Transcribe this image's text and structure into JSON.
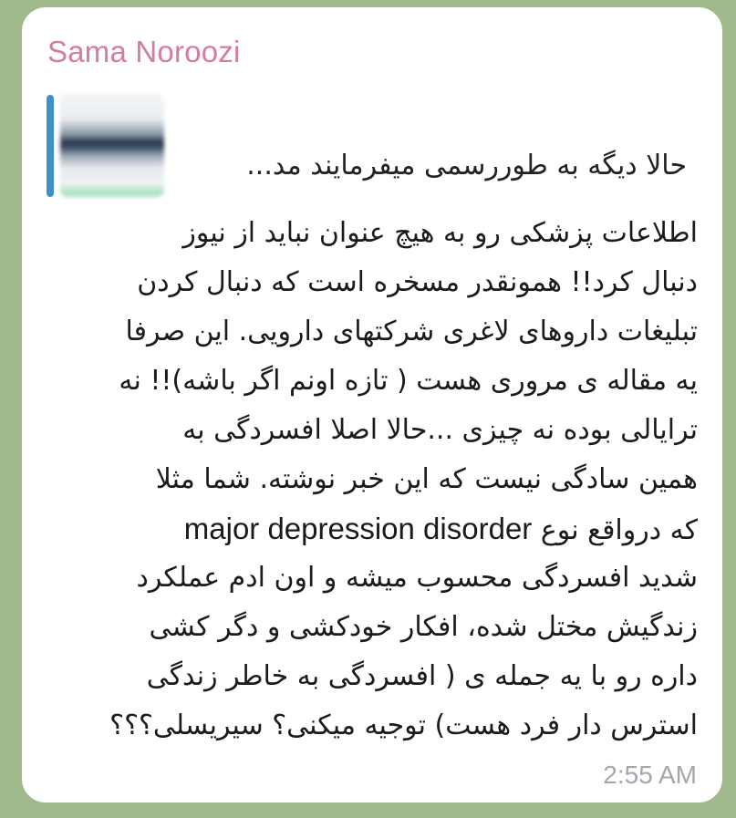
{
  "message": {
    "sender_name": "Sama Noroozi",
    "reply": {
      "quoted_text": "حالا دیگه به طوررسمی میفرمایند مد..."
    },
    "lines": [
      "اطلاعات پزشکی رو به هیچ عنوان نباید از نیوز",
      "دنبال کرد!! همونقدر مسخره است که دنبال کردن",
      "تبلیغات داروهای لاغری شرکتهای دارویی. این صرفا",
      "یه مقاله ی مروری هست ( تازه اونم اگر باشه)!! نه",
      "ترایالی بوده نه چیزی ...حالا اصلا افسردگی به",
      "همین سادگی نیست که این خبر نوشته. شما مثلا",
      "که درواقع نوع",
      "شدید افسردگی محسوب میشه و اون ادم عملکرد",
      "زندگیش مختل شده، افکار خودکشی و دگر کشی",
      "داره رو با یه جمله ی ( افسردگی به خاطر زندگی",
      "استرس دار فرد هست) توجیه میکنی؟ سیریسلی؟؟؟"
    ],
    "inline_english": "major depression disorder",
    "time": "2:55 AM"
  },
  "colors": {
    "sender_name": "#d67ba2",
    "reply_bar": "#3d90c8",
    "bubble": "#ffffff",
    "background": "#9fb98a",
    "timestamp": "#a2a8ae"
  }
}
